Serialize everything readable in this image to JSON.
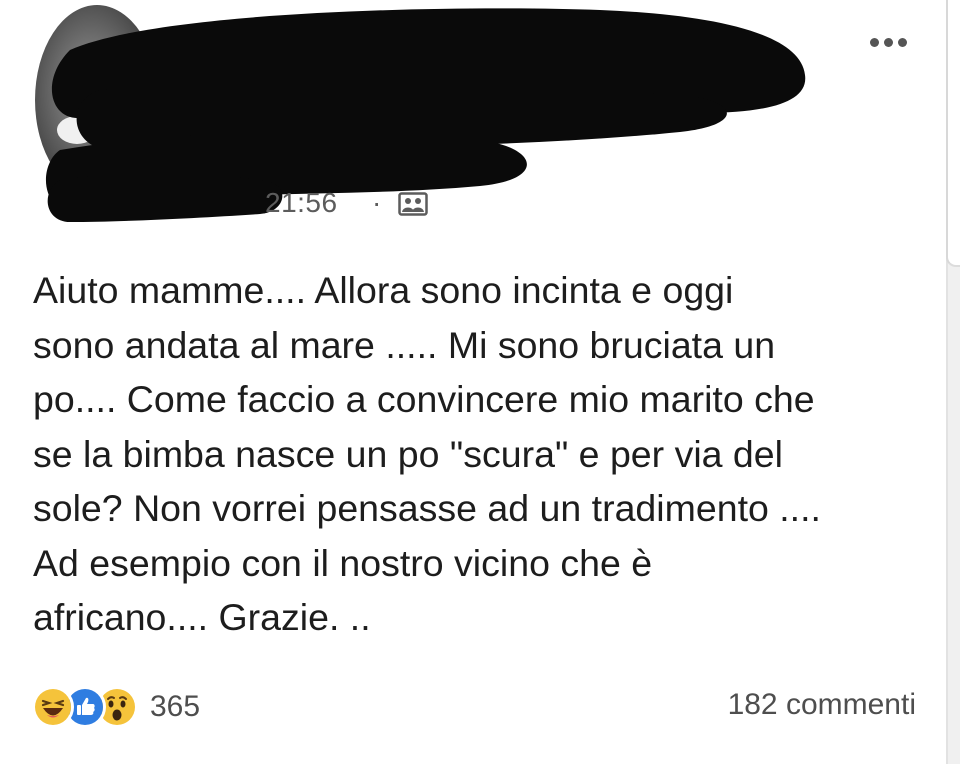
{
  "post": {
    "timestamp": "21:56",
    "separator": "·",
    "audience_icon": "friends-icon",
    "more_icon": "more-horizontal-icon",
    "body_lines": [
      "Aiuto mamme.... Allora sono incinta e oggi",
      "sono andata al mare ..... Mi sono bruciata un",
      "po.... Come faccio a convincere mio marito che",
      "se la bimba nasce un po \"scura\" e per via del",
      "sole? Non vorrei pensasse ad un tradimento ....",
      "Ad esempio con il nostro vicino che è",
      "africano.... Grazie. .."
    ]
  },
  "footer": {
    "reaction_icons": [
      "haha-icon",
      "like-icon",
      "wow-icon"
    ],
    "reaction_count": "365",
    "comments_label": "182 commenti"
  },
  "colors": {
    "redaction": "#0a0a0a",
    "text": "#1d1d1d",
    "meta": "#5c5c5c",
    "like_blue": "#2f7de1",
    "emoji_yellow": "#f5c33b"
  }
}
